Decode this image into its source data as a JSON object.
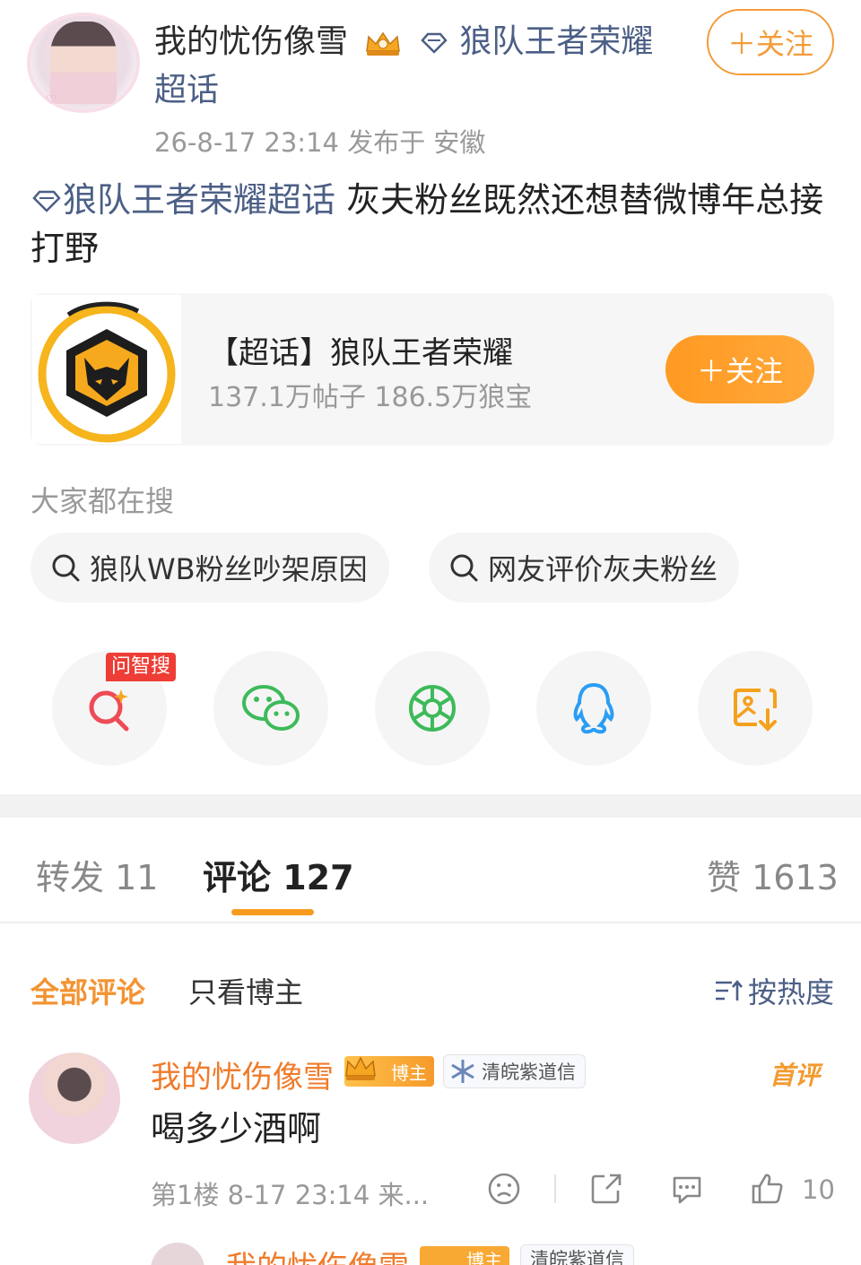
{
  "post": {
    "user_name": "我的忧伤像雪",
    "topic_text": "狼队王者荣耀超话",
    "follow_label": "＋关注",
    "meta": "26-8-17 23:14  发布于 安徽",
    "text_tag": "狼队王者荣耀超话",
    "text_body": " 灰夫粉丝既然还想替微博年总接打野"
  },
  "card": {
    "title": "【超话】狼队王者荣耀",
    "subtitle": "137.1万帖子 186.5万狼宝",
    "follow_label": "＋关注"
  },
  "search": {
    "heading": "大家都在搜",
    "chips": [
      "狼队WB粉丝吵架原因",
      "网友评价灰夫粉丝"
    ]
  },
  "share": {
    "zhisou_badge": "问智搜",
    "items": [
      "zhisou-icon",
      "wechat-icon",
      "moments-icon",
      "qq-icon",
      "save-image-icon"
    ]
  },
  "tabs": {
    "repost": "转发 11",
    "comments": "评论 127",
    "likes": "赞 1613"
  },
  "filters": {
    "all": "全部评论",
    "owner_only": "只看博主",
    "sort": "按热度"
  },
  "comment": {
    "name": "我的忧伤像雪",
    "owner_badge": "博主",
    "fan_badge": "清皖紫道信",
    "first_label": "首评",
    "text": "喝多少酒啊",
    "meta": "第1楼  8-17 23:14  来...",
    "like_count": "10"
  },
  "next_comment": {
    "name": "我的忧伤像雪",
    "owner_badge": "博主",
    "fan_badge": "清皖紫道信"
  },
  "colors": {
    "accent": "#f39a2f",
    "link": "#4c5f86",
    "red_badge": "#ee3d35"
  }
}
